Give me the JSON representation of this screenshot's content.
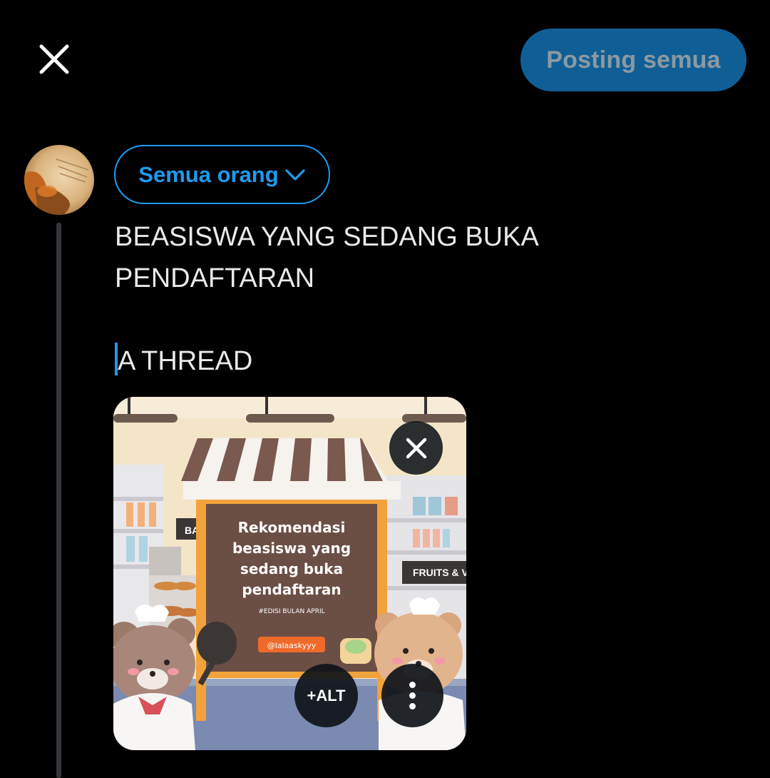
{
  "header": {
    "close_icon": "close-icon",
    "post_all_label": "Posting semua"
  },
  "composer": {
    "audience_label": "Semua orang",
    "audience_icon": "chevron-down-icon",
    "text_lines": [
      "BEASISWA YANG SEDANG BUKA",
      "PENDAFTARAN"
    ],
    "text_after_gap": "A THREAD"
  },
  "media": {
    "image_text": {
      "shop_sign_left": "BA",
      "shop_sign_right": "FRUITS & V",
      "board_line_1": "Rekomendasi",
      "board_line_2": "beasiswa yang",
      "board_line_3": "sedang buka",
      "board_line_4": "pendaftaran",
      "edition": "#EDISI BULAN APRIL",
      "handle": "@lalaaskyyy"
    },
    "remove_icon": "close-icon",
    "alt_label": "+ALT",
    "more_icon": "more-vertical-icon"
  },
  "colors": {
    "background": "#000000",
    "accent": "#1d9bf0",
    "post_button_bg": "#0f5f96",
    "post_button_text": "#8c99a2",
    "text": "#e7e9ea",
    "thread_line": "#333639"
  }
}
